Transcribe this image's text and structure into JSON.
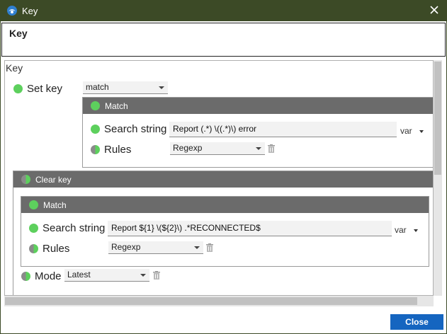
{
  "window": {
    "title": "Key",
    "app_icon": "app-logo-icon",
    "close_icon": "close-icon"
  },
  "header": {
    "title": "Key"
  },
  "content": {
    "label": "Key",
    "set_key": {
      "label": "Set key",
      "select_value": "match",
      "match_panel": {
        "title": "Match",
        "search_label": "Search string",
        "search_value": "Report (.*) \\((.*)\\) error",
        "var_label": "var",
        "rules_label": "Rules",
        "rules_value": "Regexp"
      }
    },
    "clear_key": {
      "title": "Clear key",
      "match_panel": {
        "title": "Match",
        "search_label": "Search string",
        "search_value": "Report ${1} \\(${2}\\) .*RECONNECTED$",
        "var_label": "var",
        "rules_label": "Rules",
        "rules_value": "Regexp"
      },
      "mode_label": "Mode",
      "mode_value": "Latest"
    }
  },
  "footer": {
    "close_label": "Close"
  },
  "colors": {
    "titlebar": "#3c4a26",
    "status_green": "#5dd05d",
    "panel_header": "#6b6b6b",
    "primary_button": "#1565c0"
  }
}
